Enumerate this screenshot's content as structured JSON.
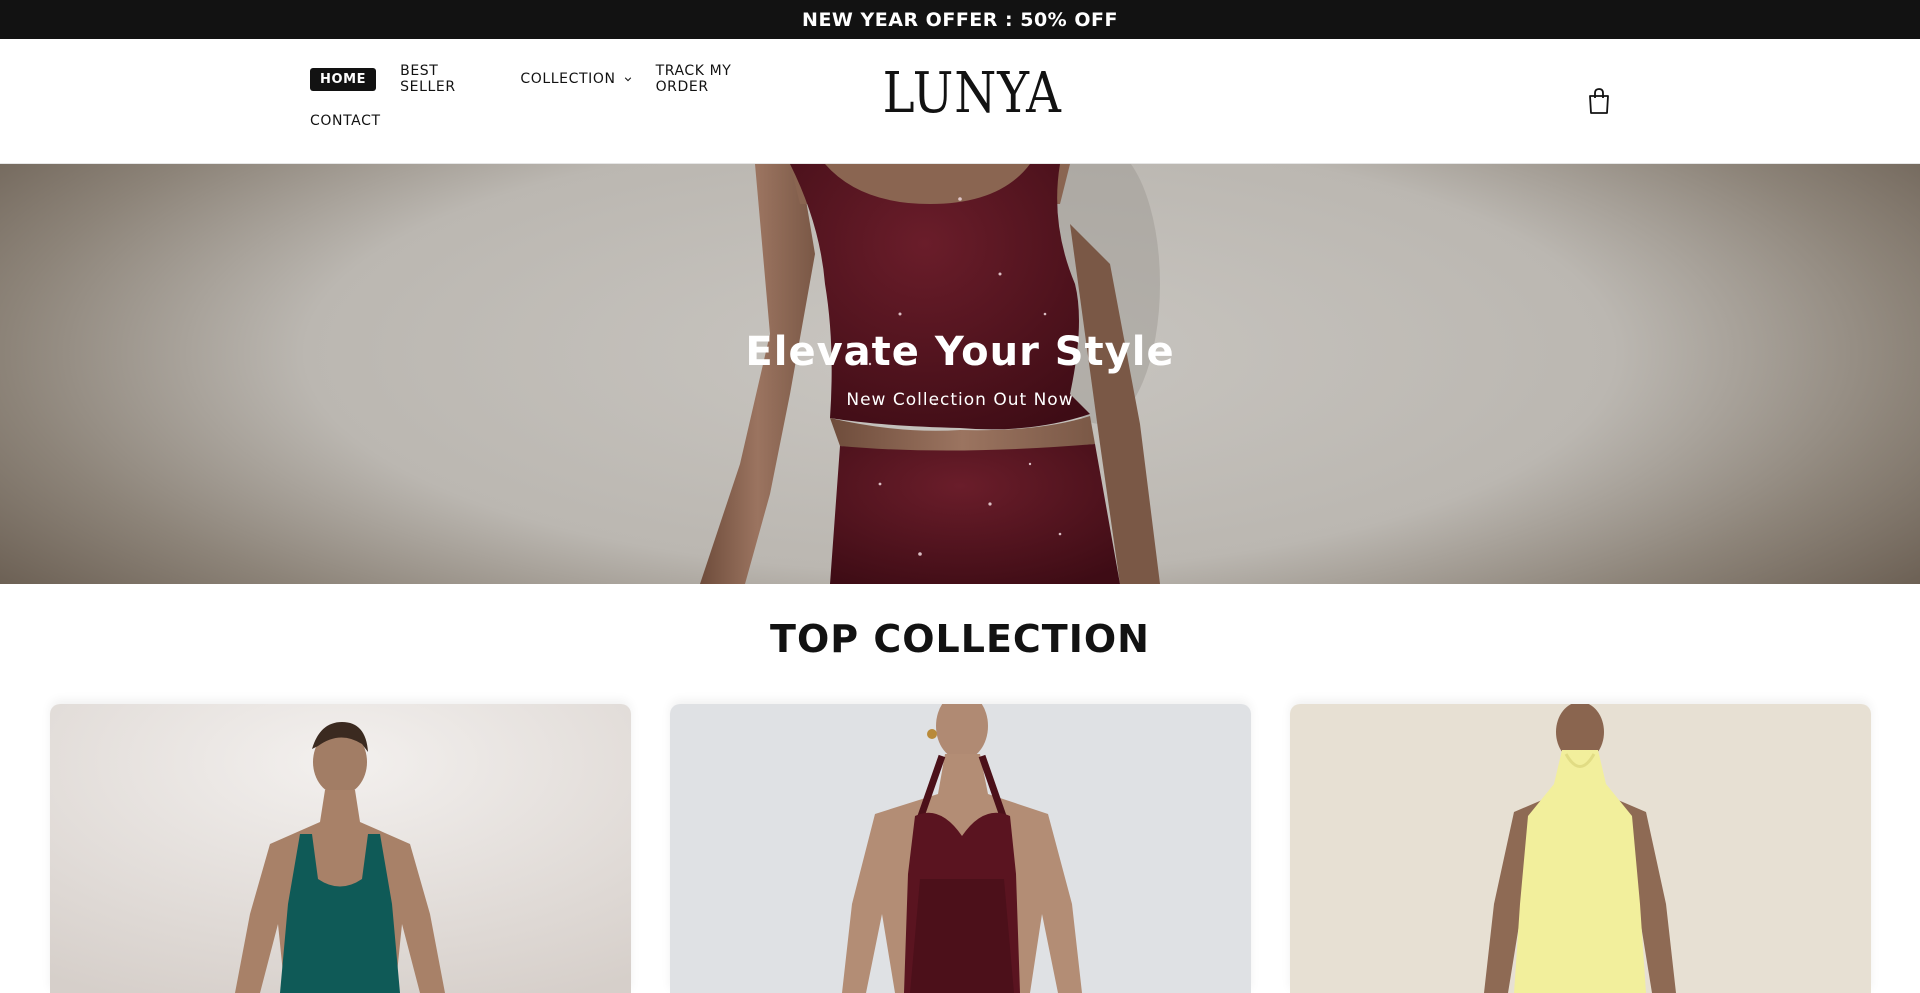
{
  "announcement": {
    "text": "NEW YEAR OFFER : 50% OFF"
  },
  "header": {
    "logo": "LUNYA",
    "nav": [
      {
        "label": "HOME",
        "active": true
      },
      {
        "label": "BEST SELLER"
      },
      {
        "label": "COLLECTION",
        "has_dropdown": true
      },
      {
        "label": "TRACK MY ORDER"
      },
      {
        "label": "CONTACT"
      }
    ],
    "cart_icon": "shopping-bag-icon"
  },
  "hero": {
    "title": "Elevate Your Style",
    "subtitle": "New Collection Out Now"
  },
  "collection": {
    "title": "TOP COLLECTION",
    "items": [
      {
        "image": "model in teal bodycon dress"
      },
      {
        "image": "model in burgundy halter sheer dress"
      },
      {
        "image": "model in pale yellow halter dress"
      }
    ]
  },
  "colors": {
    "announcement_bg": "#121212",
    "text": "#121212",
    "burgundy": "#5a1420",
    "teal": "#0f5a57",
    "pale_yellow": "#f2ef9c"
  }
}
